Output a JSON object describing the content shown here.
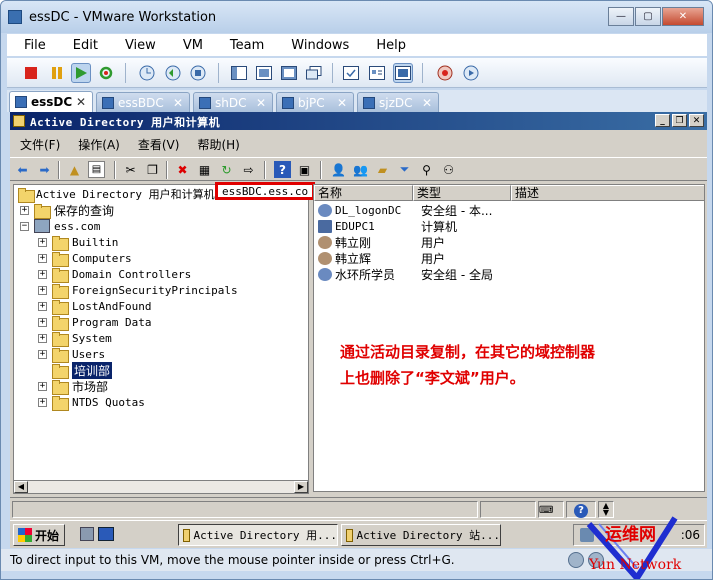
{
  "window": {
    "title": "essDC - VMware Workstation",
    "min": "▭",
    "max": "▢",
    "close": "✕"
  },
  "menu": [
    "File",
    "Edit",
    "View",
    "VM",
    "Team",
    "Windows",
    "Help"
  ],
  "tabs": [
    {
      "label": "essDC",
      "active": true
    },
    {
      "label": "essBDC"
    },
    {
      "label": "shDC"
    },
    {
      "label": "bjPC"
    },
    {
      "label": "sjzDC"
    }
  ],
  "tab_close": "✕",
  "mmc": {
    "title": "Active Directory 用户和计算机",
    "min": "_",
    "restore": "❐",
    "close": "✕",
    "menu": [
      "文件(F)",
      "操作(A)",
      "查看(V)",
      "帮助(H)"
    ],
    "tree_root": "Active Directory 用户和计算机",
    "tree_root_server": "essBDC.ess.co",
    "saved_queries": "保存的查询",
    "domain": "ess.com",
    "ous": [
      "Builtin",
      "Computers",
      "Domain Controllers",
      "ForeignSecurityPrincipals",
      "LostAndFound",
      "Program Data",
      "System",
      "Users"
    ],
    "selected_ou": "培训部",
    "after_ous": [
      "市场部",
      "NTDS Quotas"
    ],
    "columns": [
      "名称",
      "类型",
      "描述"
    ],
    "rows": [
      {
        "name": "DL_logonDC",
        "type": "安全组 - 本...",
        "icon": "group"
      },
      {
        "name": "EDUPC1",
        "type": "计算机",
        "icon": "computer"
      },
      {
        "name": "韩立刚",
        "type": "用户",
        "icon": "user"
      },
      {
        "name": "韩立辉",
        "type": "用户",
        "icon": "user"
      },
      {
        "name": "水环所学员",
        "type": "安全组 - 全局",
        "icon": "group"
      }
    ]
  },
  "annotation": [
    "通过活动目录复制，在其它的域控制器",
    "上也删除了“李文斌”用户。"
  ],
  "taskbar": {
    "start": "开始",
    "tasks": [
      "Active Directory 用...",
      "Active Directory 站..."
    ],
    "clock": ":06"
  },
  "vm_status": "To direct input to this VM, move the mouse pointer inside or press Ctrl+G.",
  "watermark": {
    "line1": "运维网",
    "line2": "Yun Network"
  },
  "colors": {
    "accent_red": "#e00000",
    "mmc_title": "#0a246a"
  }
}
